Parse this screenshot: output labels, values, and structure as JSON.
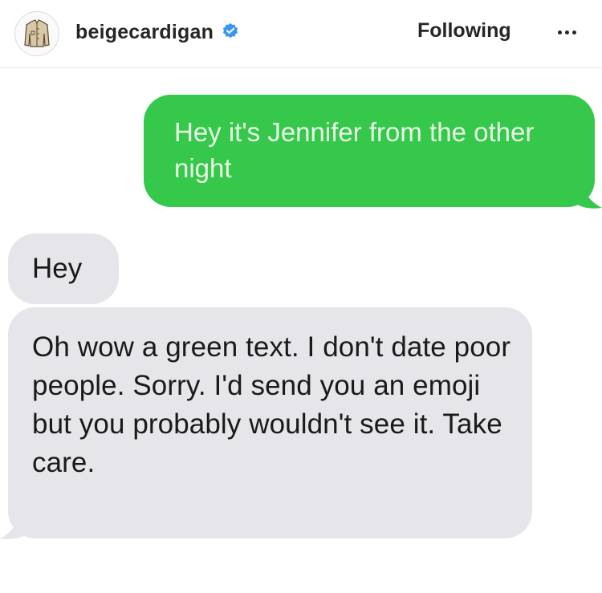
{
  "header": {
    "username": "beigecardigan",
    "verified": true,
    "follow_label": "Following",
    "more_icon": "more-horizontal-icon",
    "avatar_icon": "cardigan-icon"
  },
  "conversation": {
    "messages": [
      {
        "side": "right",
        "color": "#35c84b",
        "text": "Hey it's Jennifer from the other night"
      },
      {
        "side": "left",
        "color": "#e5e5ea",
        "text": "Hey"
      },
      {
        "side": "left",
        "color": "#e5e5ea",
        "text": "Oh wow a green text. I don't date poor people. Sorry. I'd send you an emoji but you probably wouldn't see it. Take care."
      }
    ]
  },
  "colors": {
    "verified_badge": "#3897f0",
    "sent_bubble": "#35c84b",
    "received_bubble": "#e5e5ea"
  }
}
